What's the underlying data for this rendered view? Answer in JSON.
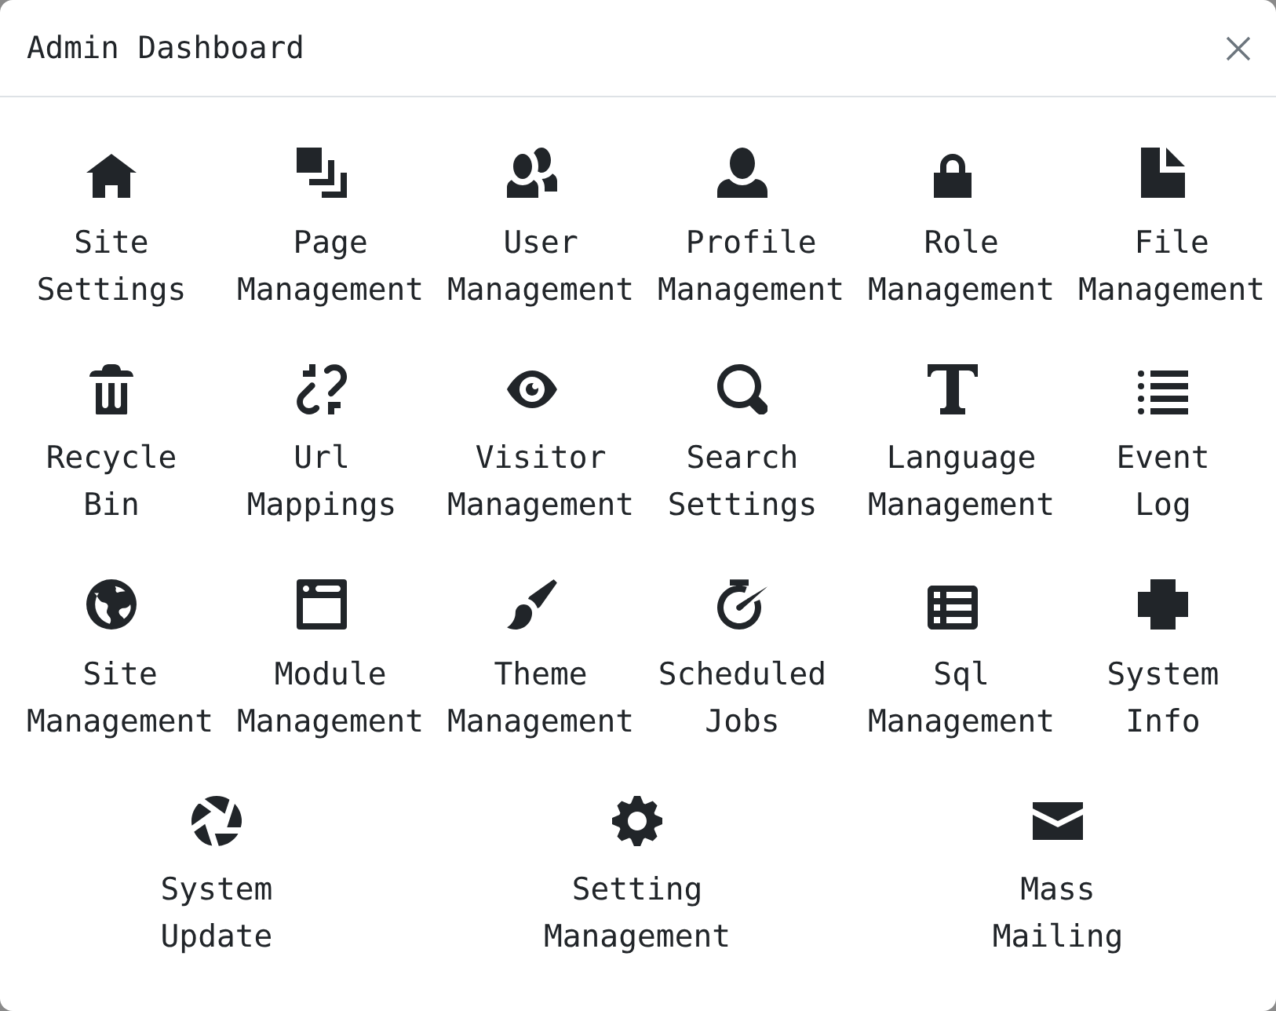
{
  "dialog": {
    "title": "Admin Dashboard"
  },
  "rows": [
    [
      {
        "label": "Site Settings"
      },
      {
        "label": "Page Management"
      },
      {
        "label": "User Management"
      },
      {
        "label": "Profile Management"
      },
      {
        "label": "Role Management"
      },
      {
        "label": "File Management"
      }
    ],
    [
      {
        "label": "Recycle Bin"
      },
      {
        "label": "Url Mappings"
      },
      {
        "label": "Visitor Management"
      },
      {
        "label": "Search Settings"
      },
      {
        "label": "Language Management"
      },
      {
        "label": "Event Log"
      }
    ],
    [
      {
        "label": "Site Management"
      },
      {
        "label": "Module Management"
      },
      {
        "label": "Theme Management"
      },
      {
        "label": "Scheduled Jobs"
      },
      {
        "label": "Sql Management"
      },
      {
        "label": "System Info"
      }
    ],
    [
      {
        "label": "System Update"
      },
      {
        "label": "Setting Management"
      },
      {
        "label": "Mass Mailing"
      }
    ]
  ]
}
